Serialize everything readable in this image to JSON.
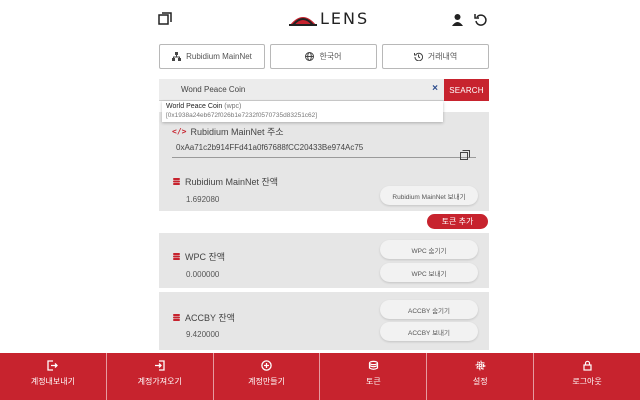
{
  "header": {
    "logo_text": "LENS",
    "icons": [
      "copy-window-icon",
      "user-icon",
      "refresh-icon"
    ]
  },
  "toolbar": {
    "network_label": "Rubidium MainNet",
    "language_label": "한국어",
    "history_label": "거래내역"
  },
  "search": {
    "value": "Wond Peace Coin",
    "button_label": "SEARCH",
    "clear_symbol": "×",
    "suggestion": {
      "name": "World Peace Coin",
      "symbol": "(wpc)",
      "address": "[0x1938a24eb672f026b1e7232f0570735d83251c62]"
    }
  },
  "address_section": {
    "code_icon": "</>",
    "title": "Rubidium MainNet 주소",
    "address": "0xAa71c2b914FFd41a0f67688fCC20433Be974Ac75"
  },
  "main_balance": {
    "title": "Rubidium MainNet 잔액",
    "value": "1.692080",
    "send_label": "Rubidium MainNet 보내기"
  },
  "add_token_label": "토큰 추가",
  "tokens": [
    {
      "title": "WPC 잔액",
      "value": "0.000000",
      "hide_label": "WPC 숨기기",
      "send_label": "WPC 보내기"
    },
    {
      "title": "ACCBY 잔액",
      "value": "9.420000",
      "hide_label": "ACCBY 숨기기",
      "send_label": "ACCBY 보내기"
    }
  ],
  "bottom_nav": [
    {
      "label": "계정내보내기",
      "icon": "export-icon"
    },
    {
      "label": "계정가져오기",
      "icon": "import-icon"
    },
    {
      "label": "계정만들기",
      "icon": "plus-circle-icon"
    },
    {
      "label": "토큰",
      "icon": "coins-icon"
    },
    {
      "label": "설정",
      "icon": "gear-icon"
    },
    {
      "label": "로그아웃",
      "icon": "lock-icon"
    }
  ],
  "colors": {
    "accent": "#c7232e",
    "panel": "#e6e6e6",
    "link": "#2b4b8c"
  }
}
